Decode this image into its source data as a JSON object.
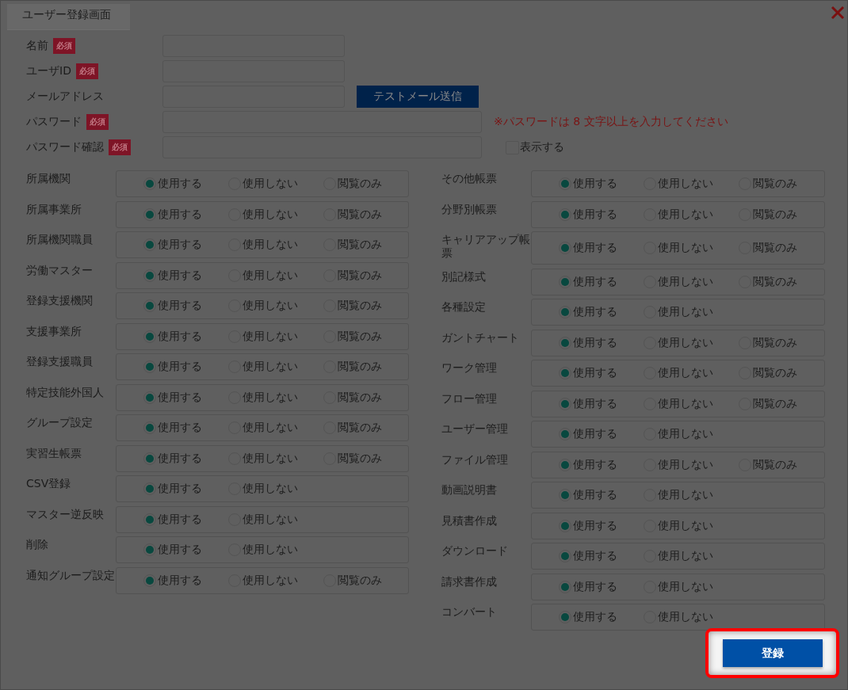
{
  "window": {
    "title": "ユーザー登録画面"
  },
  "fields": [
    {
      "label": "名前",
      "badge": "必須",
      "kind": "short"
    },
    {
      "label": "ユーザID",
      "badge": "必須",
      "kind": "short"
    },
    {
      "label": "メールアドレス",
      "kind": "short",
      "button": "テストメール送信"
    },
    {
      "label": "パスワード",
      "badge": "必須",
      "kind": "long",
      "note": "※パスワードは 8 文字以上を入力してください"
    },
    {
      "label": "パスワード確認",
      "badge": "必須",
      "kind": "long",
      "checkbox": {
        "label": "表示する",
        "checked": false
      }
    }
  ],
  "permissions_left": [
    {
      "label": "所属機関",
      "options": [
        {
          "label": "使用する",
          "selected": true
        },
        {
          "label": "使用しない",
          "selected": false
        },
        {
          "label": "閲覧のみ",
          "selected": false
        }
      ]
    },
    {
      "label": "所属事業所",
      "options": [
        {
          "label": "使用する",
          "selected": true
        },
        {
          "label": "使用しない",
          "selected": false
        },
        {
          "label": "閲覧のみ",
          "selected": false
        }
      ]
    },
    {
      "label": "所属機関職員",
      "options": [
        {
          "label": "使用する",
          "selected": true
        },
        {
          "label": "使用しない",
          "selected": false
        },
        {
          "label": "閲覧のみ",
          "selected": false
        }
      ]
    },
    {
      "label": "労働マスター",
      "options": [
        {
          "label": "使用する",
          "selected": true
        },
        {
          "label": "使用しない",
          "selected": false
        },
        {
          "label": "閲覧のみ",
          "selected": false
        }
      ]
    },
    {
      "label": "登録支援機関",
      "options": [
        {
          "label": "使用する",
          "selected": true
        },
        {
          "label": "使用しない",
          "selected": false
        },
        {
          "label": "閲覧のみ",
          "selected": false
        }
      ]
    },
    {
      "label": "支援事業所",
      "options": [
        {
          "label": "使用する",
          "selected": true
        },
        {
          "label": "使用しない",
          "selected": false
        },
        {
          "label": "閲覧のみ",
          "selected": false
        }
      ]
    },
    {
      "label": "登録支援職員",
      "options": [
        {
          "label": "使用する",
          "selected": true
        },
        {
          "label": "使用しない",
          "selected": false
        },
        {
          "label": "閲覧のみ",
          "selected": false
        }
      ]
    },
    {
      "label": "特定技能外国人",
      "options": [
        {
          "label": "使用する",
          "selected": true
        },
        {
          "label": "使用しない",
          "selected": false
        },
        {
          "label": "閲覧のみ",
          "selected": false
        }
      ]
    },
    {
      "label": "グループ設定",
      "options": [
        {
          "label": "使用する",
          "selected": true
        },
        {
          "label": "使用しない",
          "selected": false
        },
        {
          "label": "閲覧のみ",
          "selected": false
        }
      ]
    },
    {
      "label": "実習生帳票",
      "options": [
        {
          "label": "使用する",
          "selected": true
        },
        {
          "label": "使用しない",
          "selected": false
        },
        {
          "label": "閲覧のみ",
          "selected": false
        }
      ]
    },
    {
      "label": "CSV登録",
      "options": [
        {
          "label": "使用する",
          "selected": true
        },
        {
          "label": "使用しない",
          "selected": false
        }
      ]
    },
    {
      "label": "マスター逆反映",
      "options": [
        {
          "label": "使用する",
          "selected": true
        },
        {
          "label": "使用しない",
          "selected": false
        }
      ]
    },
    {
      "label": "削除",
      "options": [
        {
          "label": "使用する",
          "selected": true
        },
        {
          "label": "使用しない",
          "selected": false
        }
      ]
    },
    {
      "label": "通知グループ設定",
      "options": [
        {
          "label": "使用する",
          "selected": true
        },
        {
          "label": "使用しない",
          "selected": false
        },
        {
          "label": "閲覧のみ",
          "selected": false
        }
      ]
    }
  ],
  "permissions_right": [
    {
      "label": "その他帳票",
      "options": [
        {
          "label": "使用する",
          "selected": true
        },
        {
          "label": "使用しない",
          "selected": false
        },
        {
          "label": "閲覧のみ",
          "selected": false
        }
      ]
    },
    {
      "label": "分野別帳票",
      "options": [
        {
          "label": "使用する",
          "selected": true
        },
        {
          "label": "使用しない",
          "selected": false
        },
        {
          "label": "閲覧のみ",
          "selected": false
        }
      ]
    },
    {
      "label": "キャリアアップ帳票",
      "options": [
        {
          "label": "使用する",
          "selected": true
        },
        {
          "label": "使用しない",
          "selected": false
        },
        {
          "label": "閲覧のみ",
          "selected": false
        }
      ]
    },
    {
      "label": "別記様式",
      "options": [
        {
          "label": "使用する",
          "selected": true
        },
        {
          "label": "使用しない",
          "selected": false
        },
        {
          "label": "閲覧のみ",
          "selected": false
        }
      ]
    },
    {
      "label": "各種設定",
      "options": [
        {
          "label": "使用する",
          "selected": true
        },
        {
          "label": "使用しない",
          "selected": false
        }
      ]
    },
    {
      "label": "ガントチャート",
      "options": [
        {
          "label": "使用する",
          "selected": true
        },
        {
          "label": "使用しない",
          "selected": false
        },
        {
          "label": "閲覧のみ",
          "selected": false
        }
      ]
    },
    {
      "label": "ワーク管理",
      "options": [
        {
          "label": "使用する",
          "selected": true
        },
        {
          "label": "使用しない",
          "selected": false
        },
        {
          "label": "閲覧のみ",
          "selected": false
        }
      ]
    },
    {
      "label": "フロー管理",
      "options": [
        {
          "label": "使用する",
          "selected": true
        },
        {
          "label": "使用しない",
          "selected": false
        },
        {
          "label": "閲覧のみ",
          "selected": false
        }
      ]
    },
    {
      "label": "ユーザー管理",
      "options": [
        {
          "label": "使用する",
          "selected": true
        },
        {
          "label": "使用しない",
          "selected": false
        }
      ]
    },
    {
      "label": "ファイル管理",
      "options": [
        {
          "label": "使用する",
          "selected": true
        },
        {
          "label": "使用しない",
          "selected": false
        },
        {
          "label": "閲覧のみ",
          "selected": false
        }
      ]
    },
    {
      "label": "動画説明書",
      "options": [
        {
          "label": "使用する",
          "selected": true
        },
        {
          "label": "使用しない",
          "selected": false
        }
      ]
    },
    {
      "label": "見積書作成",
      "options": [
        {
          "label": "使用する",
          "selected": true
        },
        {
          "label": "使用しない",
          "selected": false
        }
      ]
    },
    {
      "label": "ダウンロード",
      "options": [
        {
          "label": "使用する",
          "selected": true
        },
        {
          "label": "使用しない",
          "selected": false
        }
      ]
    },
    {
      "label": "請求書作成",
      "options": [
        {
          "label": "使用する",
          "selected": true
        },
        {
          "label": "使用しない",
          "selected": false
        }
      ]
    },
    {
      "label": "コンバート",
      "options": [
        {
          "label": "使用する",
          "selected": true
        },
        {
          "label": "使用しない",
          "selected": false
        }
      ]
    }
  ],
  "submit": {
    "label": "登録",
    "highlighted": true
  }
}
